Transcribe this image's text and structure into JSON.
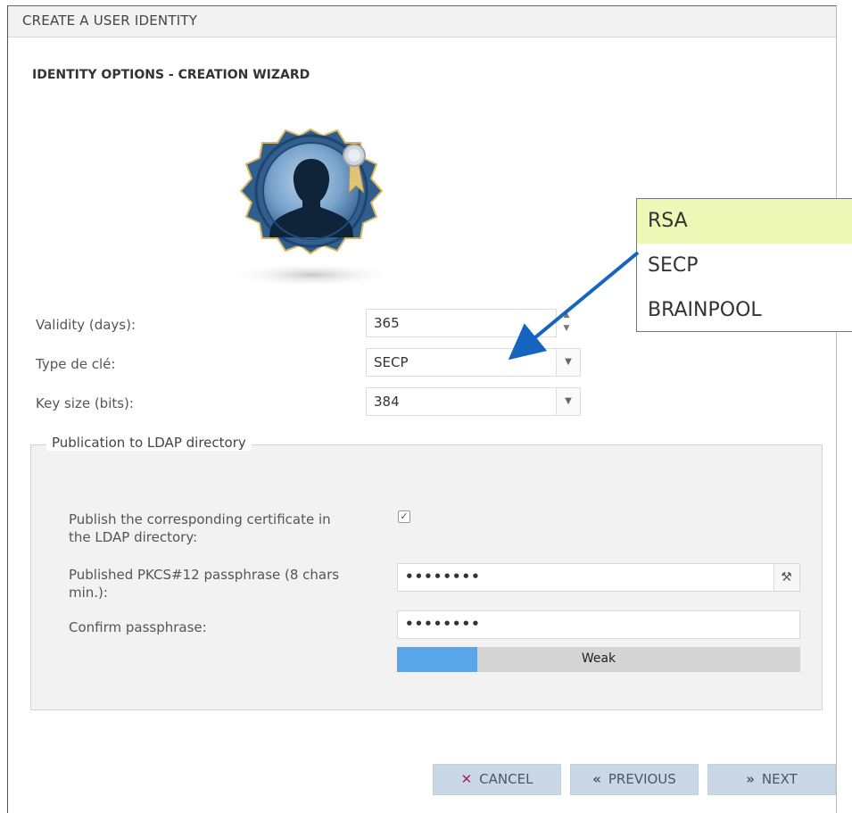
{
  "window": {
    "title": "CREATE A USER IDENTITY"
  },
  "wizard": {
    "heading": "IDENTITY OPTIONS - CREATION WIZARD"
  },
  "form": {
    "validity": {
      "label": "Validity (days):",
      "value": "365"
    },
    "key_type": {
      "label": "Type de clé:",
      "value": "SECP"
    },
    "key_size": {
      "label": "Key size (bits):",
      "value": "384"
    }
  },
  "ldap": {
    "legend": "Publication to LDAP directory",
    "publish_label_1": "Publish the corresponding certificate in",
    "publish_label_2": "the LDAP directory:",
    "publish_checked": true,
    "check_mark": "✓",
    "passphrase_label_1": "Published PKCS#12 passphrase (8 chars",
    "passphrase_label_2": "min.):",
    "passphrase_value": "••••••••",
    "confirm_label": "Confirm passphrase:",
    "confirm_value": "••••••••",
    "strength_label": "Weak",
    "strength_fraction": 0.2
  },
  "key_type_options": [
    "RSA",
    "SECP",
    "BRAINPOOL"
  ],
  "key_type_highlighted": "RSA",
  "buttons": {
    "cancel_icon": "✕",
    "cancel": "CANCEL",
    "previous_icon": "«",
    "previous": "PREVIOUS",
    "next_icon": "»",
    "next": "NEXT"
  },
  "colors": {
    "accent_arrow": "#1565c0",
    "button_bg": "#c9d8e7",
    "cancel_icon": "#b01a6a",
    "highlight": "#eef8b6",
    "strength_fill": "#5aa5e8"
  },
  "icons": {
    "avatar": "user-badge-icon",
    "dropdown": "chevron-down-icon",
    "password_generator": "key-generate-icon"
  }
}
